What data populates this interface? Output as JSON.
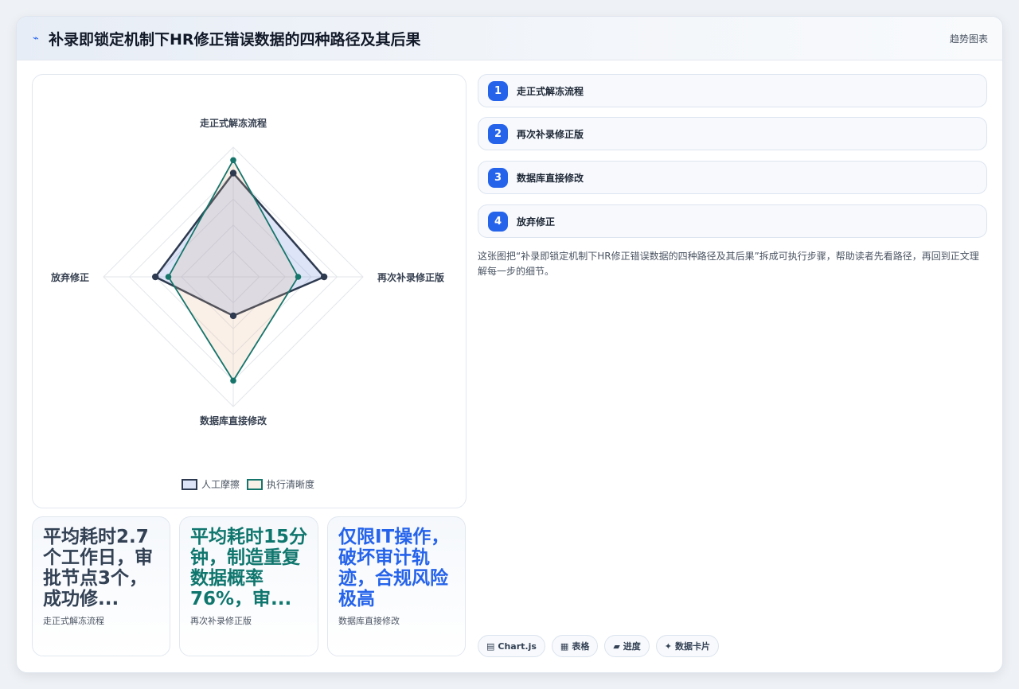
{
  "header": {
    "title": "补录即锁定机制下HR修正错误数据的四种路径及其后果",
    "logo_icon": "sparkle-icon",
    "right_label": "趋势图表"
  },
  "chart_data": {
    "type": "radar",
    "axes": [
      "走正式解冻流程",
      "再次补录修正版",
      "数据库直接修改",
      "放弃修正"
    ],
    "series": [
      {
        "name": "人工摩擦",
        "values": [
          8,
          7,
          3,
          6
        ],
        "color": "#2d3a4f",
        "fill": "rgba(99,130,220,0.22)"
      },
      {
        "name": "执行清晰度",
        "values": [
          9,
          5,
          8,
          5
        ],
        "color": "#16756b",
        "fill": "rgba(230,180,140,0.20)"
      }
    ],
    "rmax": 10,
    "grid_levels": 5,
    "legend_position": "bottom"
  },
  "stats": [
    {
      "value": "平均耗时2.7个工作日，审批节点3个，成功修...",
      "caption": "走正式解冻流程"
    },
    {
      "value": "平均耗时15分钟，制造重复数据概率76%，审...",
      "caption": "再次补录修正版"
    },
    {
      "value": "仅限IT操作，破坏审计轨迹，合规风险极高",
      "caption": "数据库直接修改"
    }
  ],
  "steps": [
    {
      "num": "1",
      "label": "走正式解冻流程"
    },
    {
      "num": "2",
      "label": "再次补录修正版"
    },
    {
      "num": "3",
      "label": "数据库直接修改"
    },
    {
      "num": "4",
      "label": "放弃修正"
    }
  ],
  "description": "这张图把“补录即锁定机制下HR修正错误数据的四种路径及其后果”拆成可执行步骤，帮助读者先看路径，再回到正文理解每一步的细节。",
  "chips": [
    {
      "icon": "chart-icon",
      "glyph": "▤",
      "label": "Chart.js"
    },
    {
      "icon": "table-icon",
      "glyph": "▦",
      "label": "表格"
    },
    {
      "icon": "progress-icon",
      "glyph": "▰",
      "label": "进度"
    },
    {
      "icon": "card-icon",
      "glyph": "✦",
      "label": "数据卡片"
    }
  ]
}
